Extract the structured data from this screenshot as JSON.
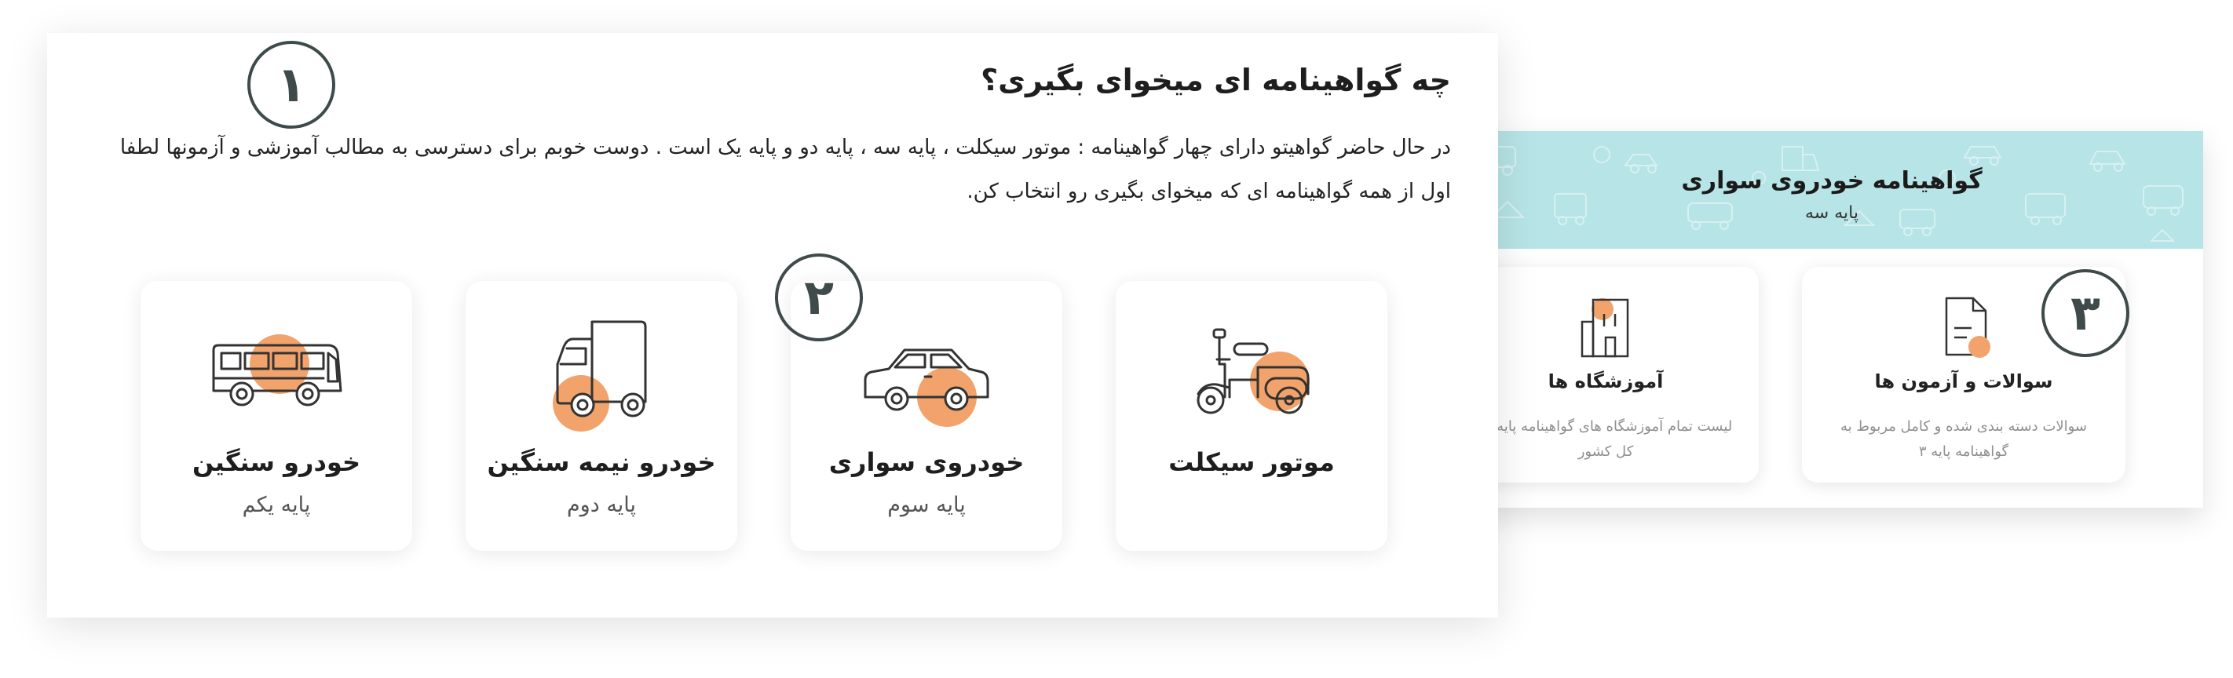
{
  "main": {
    "title": "چه گواهینامه ای میخوای بگیری؟",
    "description": "در حال حاضر گواهیتو دارای  چهار گواهینامه : موتور سیکلت ، پایه سه ، پایه دو و پایه یک است . دوست خوبم برای دسترسی به مطالب آموزشی و آزمونها لطفا اول از همه گواهینامه ای که میخوای بگیری رو انتخاب  کن.",
    "licenses": [
      {
        "name": "موتور سیکلت",
        "grade": "",
        "icon": "motorcycle-icon"
      },
      {
        "name": "خودروی سواری",
        "grade": "پایه سوم",
        "icon": "car-icon"
      },
      {
        "name": "خودرو نیمه سنگین",
        "grade": "پایه دوم",
        "icon": "truck-icon"
      },
      {
        "name": "خودرو سنگین",
        "grade": "پایه یکم",
        "icon": "bus-icon"
      }
    ]
  },
  "detail": {
    "title": "گواهینامه خودروی سواری",
    "subtitle": "پایه سه",
    "features": [
      {
        "title": "سوالات و آزمون ها",
        "description": "سوالات دسته بندی شده و کامل مربوط به گواهینامه پایه ۳",
        "icon": "document-icon"
      },
      {
        "title": "آموزشگاه ها",
        "description": "لیست تمام آموزشگاه های گواهینامه پایه در کل کشور",
        "icon": "building-icon"
      }
    ]
  },
  "steps": [
    "۱",
    "۲",
    "۳"
  ],
  "colors": {
    "accent": "#f2a36b",
    "header_bg": "#b7e4e6",
    "step_circle": "#3f4a4a"
  }
}
